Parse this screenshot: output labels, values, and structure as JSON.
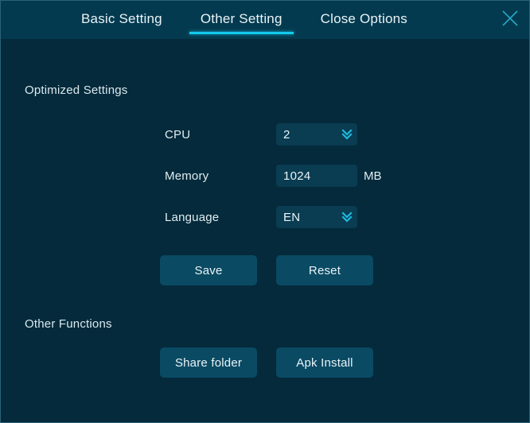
{
  "window": {
    "accent_color": "#15c9ec",
    "header_bg": "#043a4f",
    "body_bg": "#042a3b",
    "field_bg": "#0a3c52",
    "button_bg": "#0a4a63"
  },
  "header": {
    "tabs": [
      {
        "label": "Basic Setting",
        "active": false
      },
      {
        "label": "Other Setting",
        "active": true
      },
      {
        "label": "Close Options",
        "active": false
      }
    ],
    "close_icon": "close-icon"
  },
  "main": {
    "sections": [
      {
        "title": "Optimized Settings"
      },
      {
        "title": "Other Functions"
      }
    ],
    "fields": [
      {
        "label": "CPU",
        "type": "dropdown",
        "value": "2",
        "icon": "chevron-double-down-icon",
        "unit": ""
      },
      {
        "label": "Memory",
        "type": "text",
        "value": "1024",
        "placeholder": "",
        "unit": "MB"
      },
      {
        "label": "Language",
        "type": "dropdown",
        "value": "EN",
        "icon": "chevron-double-down-icon",
        "unit": ""
      }
    ],
    "buttons": {
      "save": "Save",
      "reset": "Reset",
      "share_folder": "Share folder",
      "apk_install": "Apk Install"
    }
  }
}
